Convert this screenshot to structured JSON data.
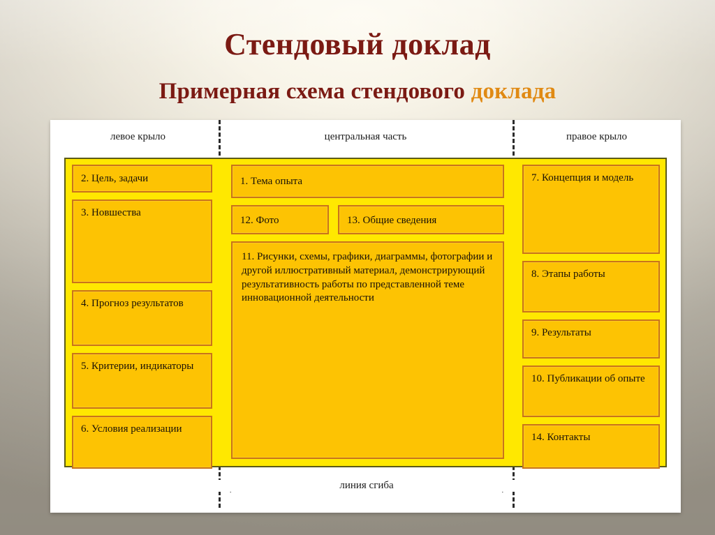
{
  "slide": {
    "title": "Стендовый доклад",
    "subtitle_main": "Примерная схема стендового ",
    "subtitle_accent": "доклада",
    "colors": {
      "title": "#7B1A13",
      "accent": "#E08A14",
      "board_background": "#FFE800",
      "board_border": "#5B5B18",
      "box_fill": "#FDC303",
      "box_border": "#C9741A",
      "panel": "#FFFFFF"
    }
  },
  "columns": {
    "left_header": "левое крыло",
    "center_header": "центральная часть",
    "right_header": "правое крыло"
  },
  "left_wing": {
    "boxes": [
      {
        "label": "2. Цель, задачи"
      },
      {
        "label": "3. Новшества"
      },
      {
        "label": "4. Прогноз результатов"
      },
      {
        "label": "5. Критерии, индикаторы"
      },
      {
        "label": "6. Условия реализации"
      }
    ]
  },
  "center_part": {
    "topic": "1. Тема опыта",
    "photo": "12. Фото",
    "general_info": "13. Общие сведения",
    "illustrations": "11. Рисунки, схемы, графики, диаграммы, фотографии и другой иллюстративный материал, демонстрирующий результативность работы по представленной теме инновационной деятельности"
  },
  "right_wing": {
    "boxes": [
      {
        "label": "7. Концепция и модель"
      },
      {
        "label": "8. Этапы работы"
      },
      {
        "label": "9. Результаты"
      },
      {
        "label": "10. Публикации об опыте"
      },
      {
        "label": "14. Контакты"
      }
    ]
  },
  "fold": {
    "label": "линия сгиба"
  }
}
